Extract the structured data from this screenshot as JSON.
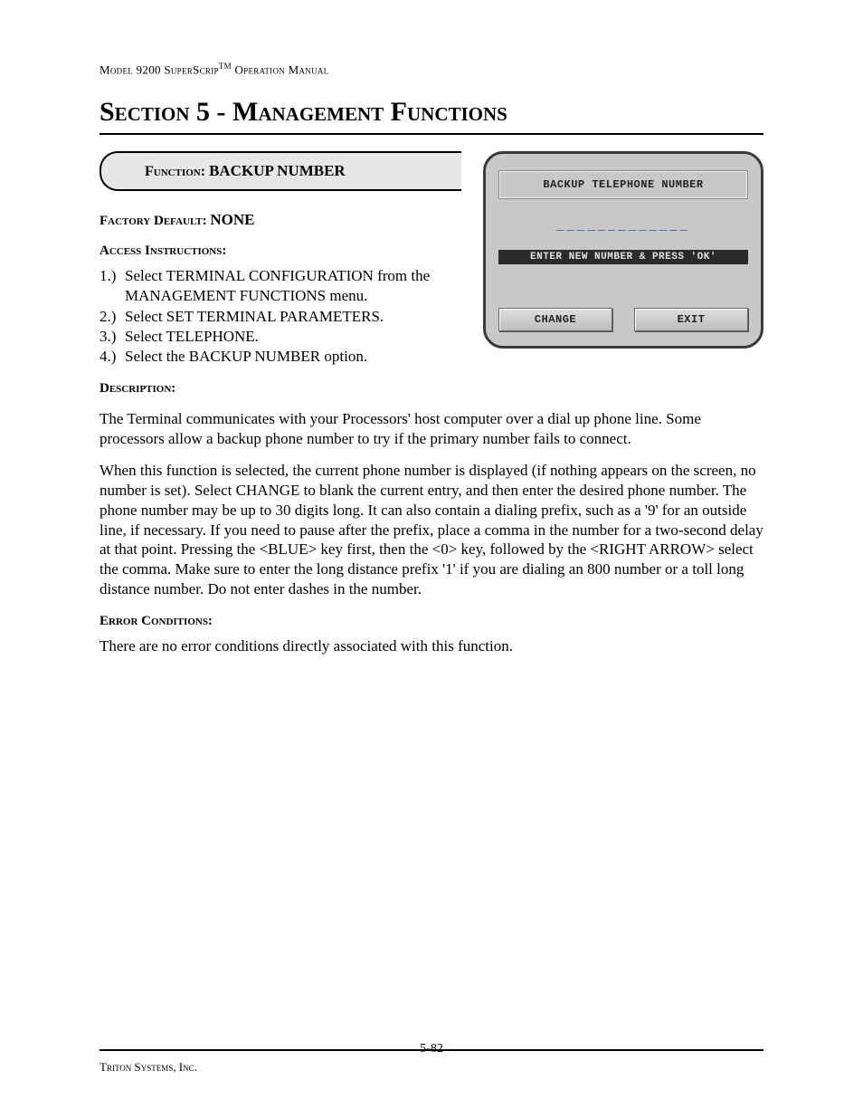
{
  "header": {
    "model_line_pre": "Model 9200 SuperScrip",
    "model_line_post": " Operation Manual",
    "tm": "TM"
  },
  "section_title": "Section 5 - Management Functions",
  "function_banner": {
    "label": "Function:  ",
    "name": "BACKUP NUMBER"
  },
  "factory_default": {
    "label": "Factory Default: ",
    "value": "NONE"
  },
  "access": {
    "label": "Access Instructions:",
    "steps": [
      {
        "num": "1.)",
        "text": "Select TERMINAL CONFIGURATION from the MANAGEMENT FUNCTIONS menu."
      },
      {
        "num": "2.)",
        "text": "Select SET TERMINAL PARAMETERS."
      },
      {
        "num": "3.)",
        "text": "Select TELEPHONE."
      },
      {
        "num": "4.)",
        "text": "Select the BACKUP NUMBER option."
      }
    ]
  },
  "screen": {
    "title": "BACKUP TELEPHONE NUMBER",
    "input_placeholder": "_____________",
    "hint": "ENTER NEW NUMBER & PRESS 'OK'",
    "buttons": {
      "change": "CHANGE",
      "exit": "EXIT"
    }
  },
  "description": {
    "label": "Description:",
    "para1": "The Terminal communicates with your Processors' host computer over a dial up phone line.  Some processors allow a backup phone number to try if the primary number fails to connect.",
    "para2": "When this function is selected, the current phone number is displayed (if nothing appears on the screen, no number is set).  Select CHANGE to blank the current entry, and then enter the desired phone number.  The phone number may be up to 30 digits long.  It can also contain a dialing prefix, such as a '9' for an outside line, if necessary.  If you need to pause after the prefix, place a comma in the number for a two-second delay at that point.  Pressing the <BLUE> key first, then the <0> key, followed by the <RIGHT ARROW> select the comma.  Make sure to enter the long distance prefix '1' if you are dialing an 800 number or a toll long distance number.  Do not enter dashes in the number."
  },
  "errors": {
    "label": "Error Conditions:",
    "text": "There are no error conditions directly associated with this function."
  },
  "footer": {
    "company": "Triton Systems, Inc.",
    "page": "5-82"
  }
}
